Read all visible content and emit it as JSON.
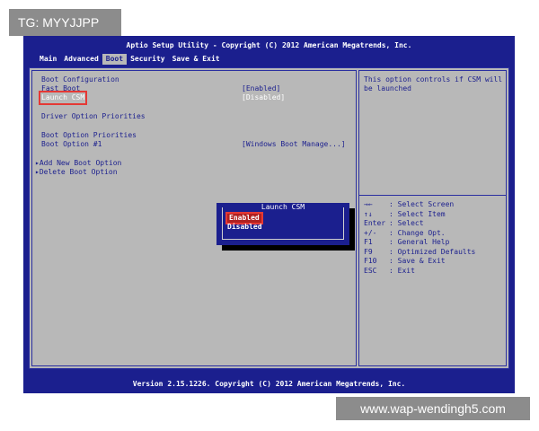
{
  "watermarks": {
    "top": "TG: MYYJJPP",
    "bottom": "www.wap-wendingh5.com"
  },
  "title": "Aptio Setup Utility - Copyright (C) 2012 American Megatrends, Inc.",
  "tabs": [
    {
      "label": "Main"
    },
    {
      "label": "Advanced"
    },
    {
      "label": "Boot",
      "active": true
    },
    {
      "label": "Security"
    },
    {
      "label": "Save & Exit"
    }
  ],
  "left": {
    "boot_configuration": "Boot Configuration",
    "fast_boot": {
      "label": "Fast Boot",
      "value": "[Enabled]"
    },
    "launch_csm": {
      "label": "Launch CSM",
      "value": "[Disabled]"
    },
    "driver_option_priorities": "Driver Option Priorities",
    "boot_option_priorities": "Boot Option Priorities",
    "boot_option_1": {
      "label": "Boot Option #1",
      "value": "[Windows Boot Manage...]"
    },
    "add_new_boot_option": "Add New Boot Option",
    "delete_boot_option": "Delete Boot Option"
  },
  "help": {
    "text": "This option controls if CSM will be launched",
    "keys": [
      {
        "key": "→←",
        "desc": ": Select Screen"
      },
      {
        "key": "↑↓",
        "desc": ": Select Item"
      },
      {
        "key": "Enter",
        "desc": ": Select"
      },
      {
        "key": "+/-",
        "desc": ": Change Opt."
      },
      {
        "key": "F1",
        "desc": ": General Help"
      },
      {
        "key": "F9",
        "desc": ": Optimized Defaults"
      },
      {
        "key": "F10",
        "desc": ": Save & Exit"
      },
      {
        "key": "ESC",
        "desc": ": Exit"
      }
    ]
  },
  "popup": {
    "title": "Launch CSM",
    "options": [
      "Enabled",
      "Disabled"
    ],
    "selected": "Enabled"
  },
  "footer": "Version 2.15.1226. Copyright (C) 2012 American Megatrends, Inc.",
  "colors": {
    "bios_blue": "#1b1f8e",
    "bios_gray": "#b8b8b8",
    "highlight_red": "#e53935"
  }
}
